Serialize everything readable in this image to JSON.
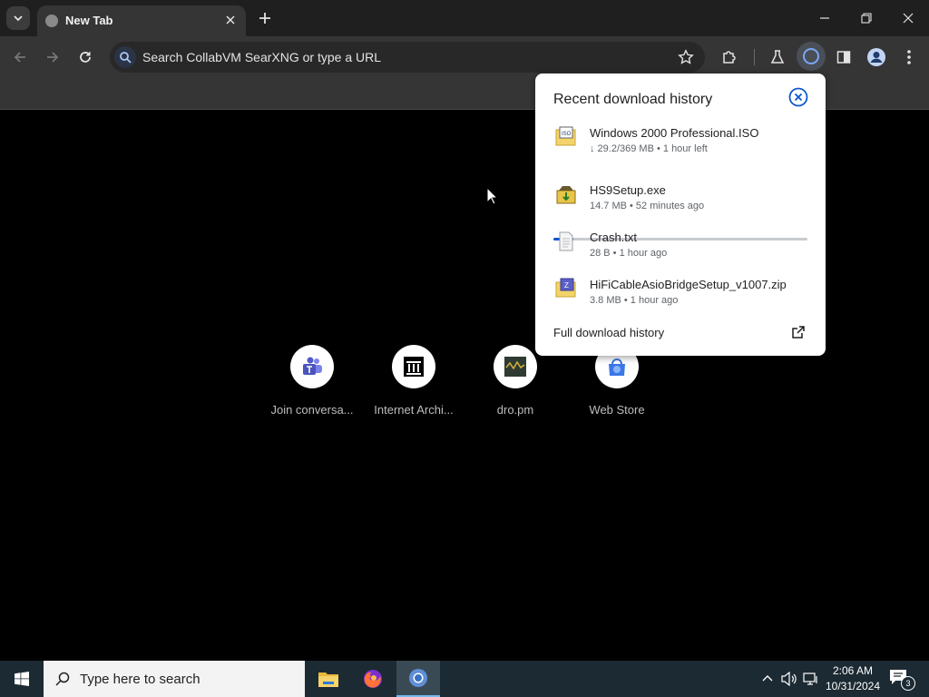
{
  "browser": {
    "tab": {
      "title": "New Tab"
    },
    "omnibox": {
      "placeholder": "Search CollabVM SearXNG or type a URL"
    }
  },
  "shortcuts": [
    {
      "label": "Join conversa...",
      "icon": "teams-icon"
    },
    {
      "label": "Internet Archi...",
      "icon": "archive-icon"
    },
    {
      "label": "dro.pm",
      "icon": "dropm-icon"
    },
    {
      "label": "Web Store",
      "icon": "webstore-icon"
    }
  ],
  "downloads": {
    "title": "Recent download history",
    "items": [
      {
        "name": "Windows 2000 Professional.ISO",
        "meta": "↓ 29.2/369 MB • 1 hour left",
        "progress": 0.08,
        "icon": "iso-file-icon"
      },
      {
        "name": "HS9Setup.exe",
        "meta": "14.7 MB • 52 minutes ago",
        "icon": "installer-icon"
      },
      {
        "name": "Crash.txt",
        "meta": "28 B • 1 hour ago",
        "icon": "text-file-icon"
      },
      {
        "name": "HiFiCableAsioBridgeSetup_v1007.zip",
        "meta": "3.8 MB • 1 hour ago",
        "icon": "zip-file-icon"
      }
    ],
    "full_history": "Full download history"
  },
  "taskbar": {
    "search_placeholder": "Type here to search",
    "time": "2:06 AM",
    "date": "10/31/2024",
    "notification_count": "3"
  },
  "colors": {
    "accent": "#0b57d0",
    "toolbar": "#353535",
    "taskbar": "#1c2a33"
  }
}
